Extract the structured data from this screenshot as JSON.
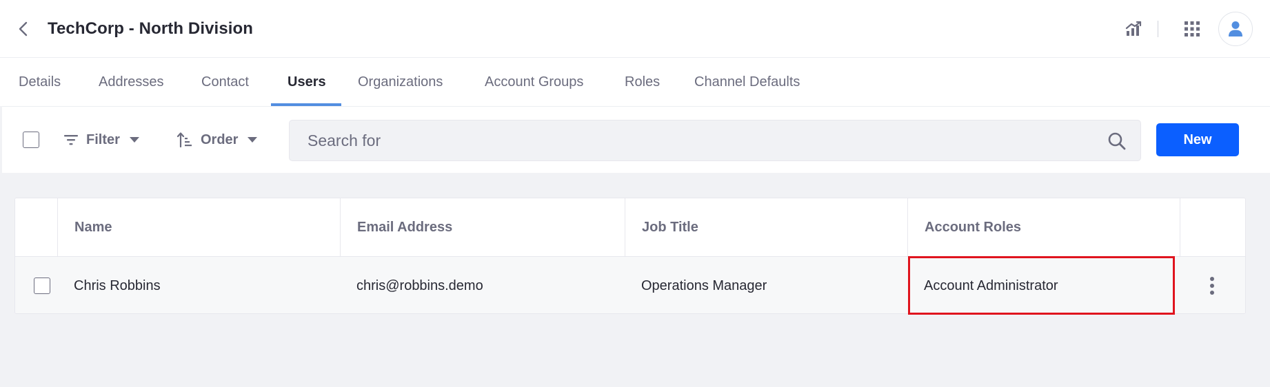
{
  "header": {
    "title": "TechCorp - North Division",
    "icons": {
      "back": "chevron-left-icon",
      "analytics": "analytics-icon",
      "apps": "apps-grid-icon",
      "user": "user-icon"
    }
  },
  "tabs": [
    {
      "label": "Details",
      "active": false
    },
    {
      "label": "Addresses",
      "active": false
    },
    {
      "label": "Contact",
      "active": false
    },
    {
      "label": "Users",
      "active": true
    },
    {
      "label": "Organizations",
      "active": false
    },
    {
      "label": "Account Groups",
      "active": false
    },
    {
      "label": "Roles",
      "active": false
    },
    {
      "label": "Channel Defaults",
      "active": false
    }
  ],
  "toolbar": {
    "filter_label": "Filter",
    "order_label": "Order",
    "search_placeholder": "Search for",
    "search_value": "",
    "new_label": "New"
  },
  "table": {
    "columns": [
      "Name",
      "Email Address",
      "Job Title",
      "Account Roles"
    ],
    "rows": [
      {
        "name": "Chris Robbins",
        "email": "chris@robbins.demo",
        "job_title": "Operations Manager",
        "account_roles": "Account Administrator",
        "highlighted_cell": "account_roles"
      }
    ]
  },
  "colors": {
    "primary": "#0b5fff",
    "tab_active_underline": "#528ee0",
    "highlight": "#e0141e",
    "text_primary": "#272833",
    "text_secondary": "#6b6c7e",
    "page_background": "#f1f2f5"
  }
}
